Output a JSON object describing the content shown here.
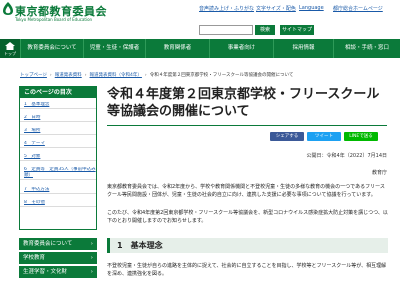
{
  "header": {
    "site_name": "東京都教育委員会",
    "site_name_en": "Tokyo Metropolitan Board of Education",
    "util_links": [
      "音声読み上げ・ふりがな",
      "文字サイズ・配色",
      "Language",
      "都庁総合ホームページ"
    ],
    "search_button": "検索",
    "sitemap_button": "サイトマップ"
  },
  "nav": {
    "home_label": "トップ",
    "items": [
      "教育委員会について",
      "児童・生徒・保護者",
      "教育関係者",
      "事業者向け",
      "採用情報",
      "相談・手続・窓口"
    ]
  },
  "breadcrumbs": {
    "items": [
      "トップページ",
      "報道発表資料",
      "報道発表資料（令和4年）"
    ],
    "current": "令和４年度第２回東京都学校・フリースクール等協議会の開催について"
  },
  "toc": {
    "heading": "このページの目次",
    "items": [
      "1　基本理念",
      "2　日時",
      "3　場所",
      "4　テーマ",
      "5　対象",
      "6　定員等　定員35人（事前申込み順）",
      "7　申込方法",
      "8　その他"
    ]
  },
  "side_links": [
    "教育委員会について",
    "学校教育",
    "生涯学習・文化財"
  ],
  "main": {
    "title": "令和４年度第２回東京都学校・フリースクール等協議会の開催について",
    "share": [
      "シェアする",
      "ツイート",
      "LINEで送る"
    ],
    "published": "公開日：令和4年（2022）7月14日",
    "department": "教育庁",
    "intro_paragraphs": [
      "東京都教育委員会では、令和2年度から、学校や教育関係機関と不登校児童・生徒の多様な教育の機会の一つであるフリースクール等民間施設・団体が、児童・生徒の社会的自立に向け、連携した支援に必要な事項について協議を行っています。",
      "このたび、令和4年度第2回東京都学校・フリースクール等協議会を、新型コロナウイルス感染症拡大防止対策を講じつつ、以下のとおり開催しますのでお知らせします。"
    ],
    "section_heading": "1　基本理念",
    "section_text": "不登校児童・生徒が自らの進路を主体的に捉えて、社会的に自立することを目指し、学校等とフリースクール等が、相互理解を深め、連携強化を図る。"
  },
  "colors": {
    "brand_green": "#0b7a3a",
    "link_blue": "#1a5aa8",
    "section_bg": "#e6efe9"
  }
}
